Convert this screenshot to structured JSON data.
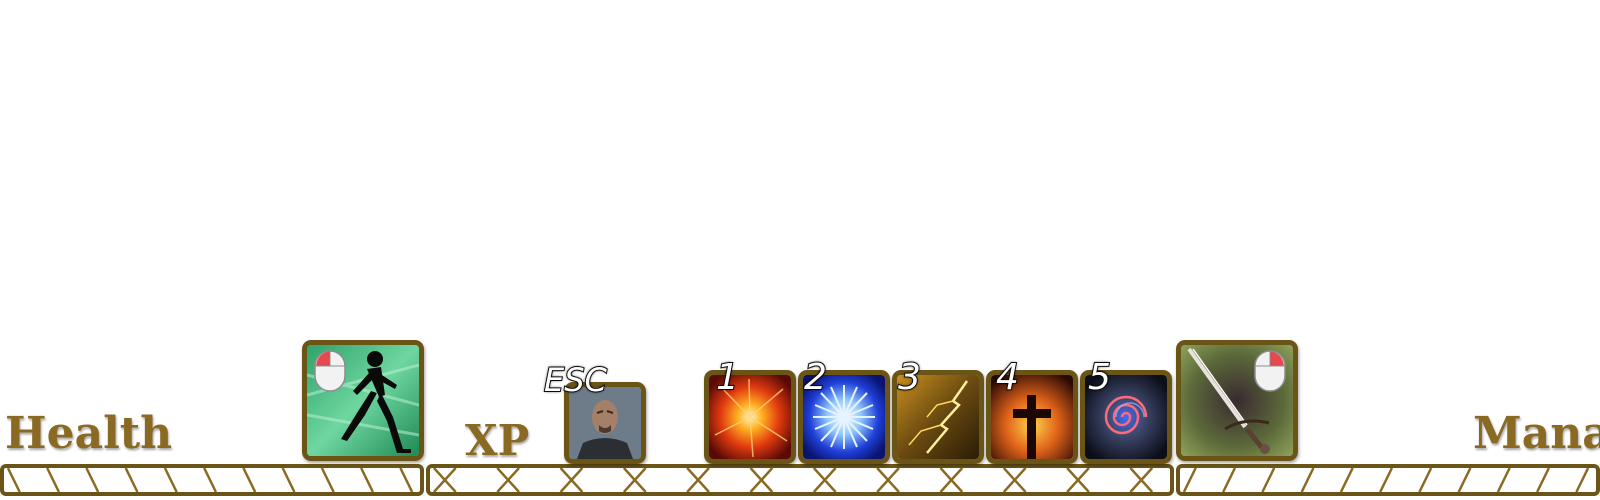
{
  "labels": {
    "health": "Health",
    "xp": "XP",
    "mana": "Mana"
  },
  "hotkeys": {
    "menu": "ESC",
    "skill1": "1",
    "skill2": "2",
    "skill3": "3",
    "skill4": "4",
    "skill5": "5"
  },
  "slots": {
    "sprint": "sprint-skill-icon",
    "character": "character-portrait-icon",
    "skill1": "fire-explosion-icon",
    "skill2": "frost-burst-icon",
    "skill3": "lightning-icon",
    "skill4": "holy-cross-icon",
    "skill5": "vortex-icon",
    "attack": "sword-attack-icon"
  },
  "colors": {
    "frame": "#6b5516",
    "label": "#8a6a22"
  }
}
